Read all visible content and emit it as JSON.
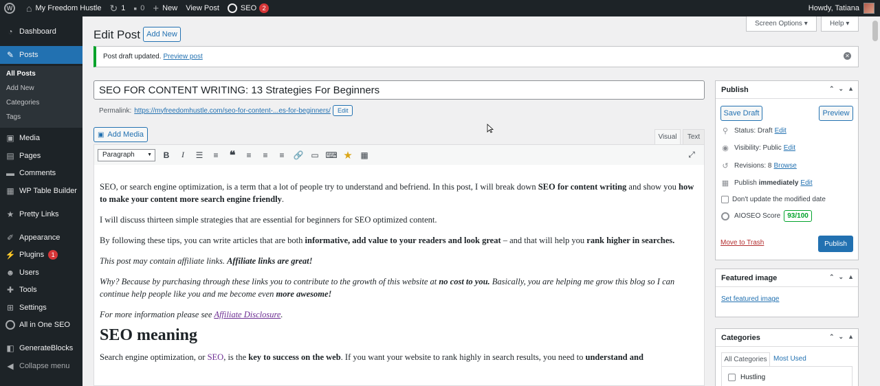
{
  "adminbar": {
    "site_name": "My Freedom Hustle",
    "updates_count": "1",
    "comments_count": "0",
    "new_label": "New",
    "view_post_label": "View Post",
    "seo_label": "SEO",
    "seo_badge": "2",
    "howdy": "Howdy, Tatiana"
  },
  "sidebar": {
    "dashboard": "Dashboard",
    "posts": "Posts",
    "posts_sub": [
      "All Posts",
      "Add New",
      "Categories",
      "Tags"
    ],
    "media": "Media",
    "pages": "Pages",
    "comments": "Comments",
    "wp_table_builder": "WP Table Builder",
    "pretty_links": "Pretty Links",
    "appearance": "Appearance",
    "plugins": "Plugins",
    "plugins_badge": "1",
    "users": "Users",
    "tools": "Tools",
    "settings": "Settings",
    "all_in_one_seo": "All in One SEO",
    "generateblocks": "GenerateBlocks",
    "collapse": "Collapse menu"
  },
  "header": {
    "title": "Edit Post",
    "add_new": "Add New",
    "screen_options": "Screen Options ▾",
    "help": "Help ▾"
  },
  "notice": {
    "text": "Post draft updated.",
    "link": "Preview post"
  },
  "post": {
    "title": "SEO FOR CONTENT WRITING: 13 Strategies For Beginners",
    "permalink_label": "Permalink:",
    "permalink_url": "https://myfreedomhustle.com/seo-for-content-...es-for-beginners/",
    "permalink_edit": "Edit"
  },
  "editor": {
    "add_media": "Add Media",
    "tab_visual": "Visual",
    "tab_text": "Text",
    "format": "Paragraph",
    "p1_a": "SEO, or search engine optimization, is a term that a lot of people try to understand and befriend. In this post, I will break down ",
    "p1_b": "SEO for content writing",
    "p1_c": " and show you ",
    "p1_d": "how to make your content more search engine friendly",
    "p1_e": ".",
    "p2": "I will discuss thirteen simple strategies that are essential for beginners for SEO optimized content.",
    "p3_a": "By following these tips, you can write articles that are both ",
    "p3_b": "informative, add value to your readers and look great",
    "p3_c": " – and that will help you ",
    "p3_d": "rank higher in searches.",
    "p4_a": "This post may contain affiliate links. ",
    "p4_b": "Affiliate links are great!",
    "p5_a": "Why? Because by purchasing through these links you to contribute to the growth of this website at ",
    "p5_b": "no cost to you.",
    "p5_c": " Basically, you are helping me grow this blog so I can continue help people like you and me become even ",
    "p5_d": "more awesome!",
    "p6_a": "For more information please see ",
    "p6_link": "Affiliate Disclosure",
    "p6_c": ".",
    "h2": "SEO meaning",
    "p7_a": "Search engine optimization, or ",
    "p7_link": "SEO",
    "p7_b": ", is the ",
    "p7_c": "key to success on the web",
    "p7_d": ". If you want your website to rank highly in search results, you need to ",
    "p7_e": "understand and"
  },
  "publish": {
    "title": "Publish",
    "save_draft": "Save Draft",
    "preview": "Preview",
    "status_label": "Status:",
    "status_value": "Draft",
    "visibility_label": "Visibility:",
    "visibility_value": "Public",
    "revisions_label": "Revisions:",
    "revisions_value": "8",
    "browse": "Browse",
    "publish_label": "Publish",
    "publish_value": "immediately",
    "edit": "Edit",
    "dont_update": "Don't update the modified date",
    "aioseo_label": "AIOSEO Score",
    "aioseo_score": "93/100",
    "move_to_trash": "Move to Trash",
    "publish_button": "Publish"
  },
  "featured_image": {
    "title": "Featured image",
    "link": "Set featured image"
  },
  "categories": {
    "title": "Categories",
    "tab_all": "All Categories",
    "tab_most_used": "Most Used",
    "item1": "Hustling"
  }
}
